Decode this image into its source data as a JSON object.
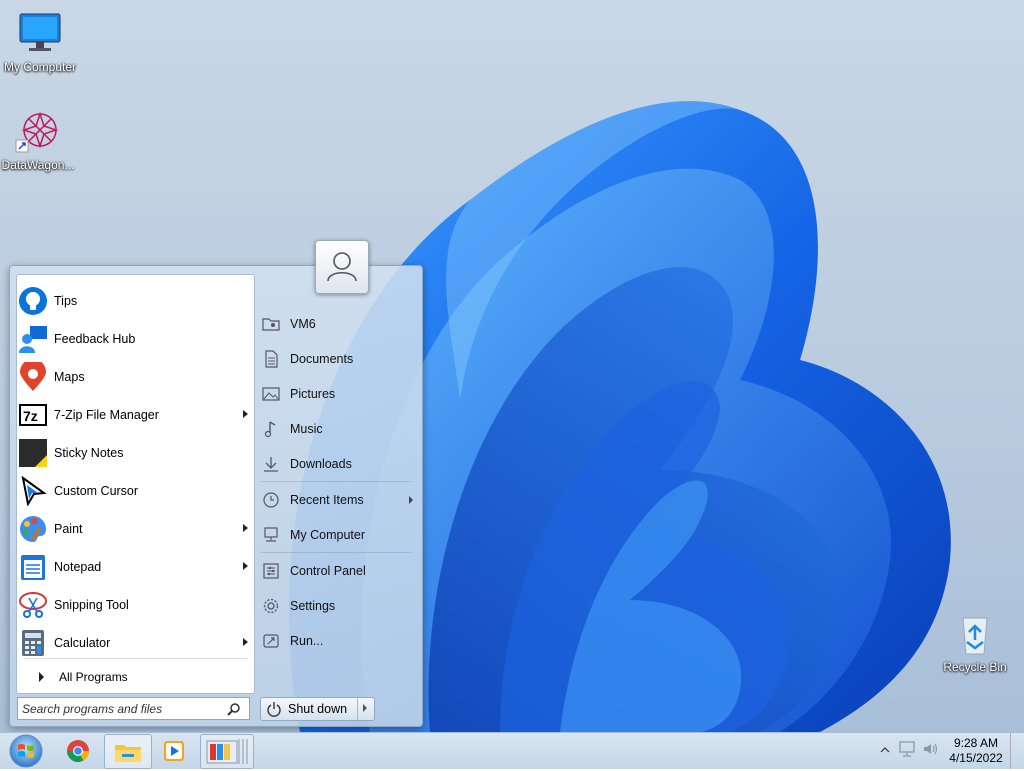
{
  "desktop": {
    "icons": [
      {
        "label": "My Computer",
        "icon": "monitor-icon"
      },
      {
        "label": "DataWagon...",
        "icon": "datawagon-shortcut-icon"
      },
      {
        "label": "Recycle Bin",
        "icon": "recycle-bin-icon"
      }
    ]
  },
  "start_menu": {
    "pinned_apps": [
      {
        "label": "Tips",
        "icon": "tips-icon",
        "has_submenu": false
      },
      {
        "label": "Feedback Hub",
        "icon": "feedback-hub-icon",
        "has_submenu": false
      },
      {
        "label": "Maps",
        "icon": "maps-icon",
        "has_submenu": false
      },
      {
        "label": "7-Zip File Manager",
        "icon": "7zip-icon",
        "has_submenu": true
      },
      {
        "label": "Sticky Notes",
        "icon": "sticky-notes-icon",
        "has_submenu": false
      },
      {
        "label": "Custom Cursor",
        "icon": "cursor-icon",
        "has_submenu": false
      },
      {
        "label": "Paint",
        "icon": "paint-icon",
        "has_submenu": true
      },
      {
        "label": "Notepad",
        "icon": "notepad-icon",
        "has_submenu": true
      },
      {
        "label": "Snipping Tool",
        "icon": "snipping-tool-icon",
        "has_submenu": false
      },
      {
        "label": "Calculator",
        "icon": "calculator-icon",
        "has_submenu": true
      }
    ],
    "all_programs_label": "All Programs",
    "search_placeholder": "Search programs and files",
    "places": [
      {
        "label": "VM6",
        "icon": "user-folder-icon"
      },
      {
        "label": "Documents",
        "icon": "documents-icon"
      },
      {
        "label": "Pictures",
        "icon": "pictures-icon"
      },
      {
        "label": "Music",
        "icon": "music-icon"
      },
      {
        "label": "Downloads",
        "icon": "downloads-icon"
      },
      {
        "label": "Recent Items",
        "icon": "clock-icon"
      },
      {
        "label": "My Computer",
        "icon": "computer-icon"
      },
      {
        "label": "Control Panel",
        "icon": "control-panel-icon"
      },
      {
        "label": "Settings",
        "icon": "gear-icon"
      },
      {
        "label": "Run...",
        "icon": "run-icon"
      }
    ],
    "shutdown_label": "Shut down"
  },
  "taskbar": {
    "pinned": [
      "chrome-icon",
      "file-explorer-icon",
      "media-player-icon",
      "window-stack-icon"
    ],
    "clock": {
      "time": "9:28 AM",
      "date": "4/15/2022"
    }
  },
  "colors": {
    "accent": "#1a6fe0",
    "wallpaper_bg": "#c2d3e6"
  }
}
